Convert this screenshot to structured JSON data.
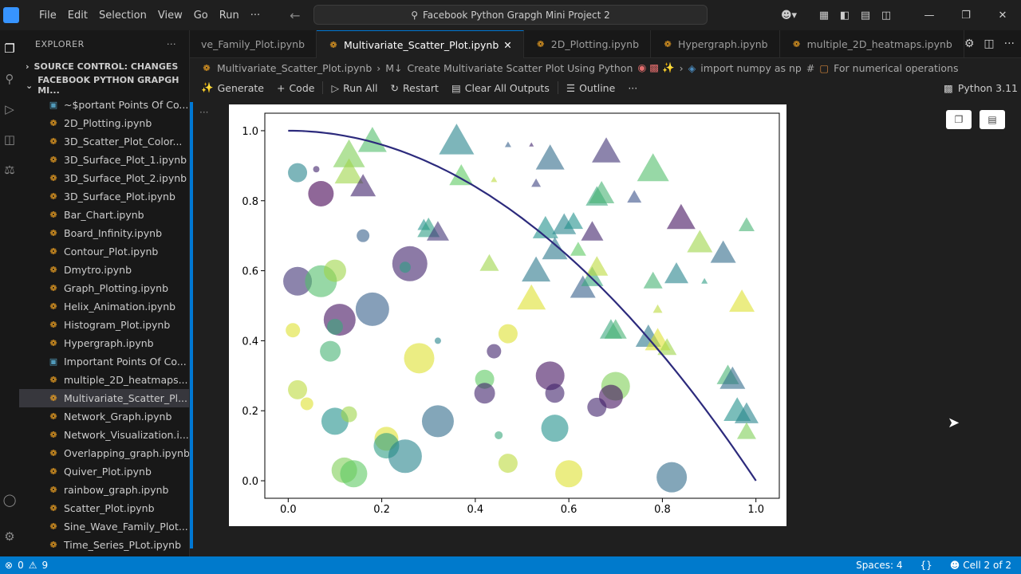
{
  "menu": [
    "File",
    "Edit",
    "Selection",
    "View",
    "Go",
    "Run",
    "···"
  ],
  "search": {
    "text": "Facebook Python Grapgh Mini Project 2"
  },
  "explorer": {
    "title": "EXPLORER",
    "source_control": "SOURCE CONTROL: CHANGES",
    "folder": "FACEBOOK PYTHON GRAPGH MI...",
    "files": [
      {
        "name": "~$portant Points Of Co...",
        "type": "doc"
      },
      {
        "name": "2D_Plotting.ipynb",
        "type": "nb"
      },
      {
        "name": "3D_Scatter_Plot_Color...",
        "type": "nb"
      },
      {
        "name": "3D_Surface_Plot_1.ipynb",
        "type": "nb"
      },
      {
        "name": "3D_Surface_Plot_2.ipynb",
        "type": "nb"
      },
      {
        "name": "3D_Surface_Plot.ipynb",
        "type": "nb"
      },
      {
        "name": "Bar_Chart.ipynb",
        "type": "nb"
      },
      {
        "name": "Board_Infinity.ipynb",
        "type": "nb"
      },
      {
        "name": "Contour_Plot.ipynb",
        "type": "nb"
      },
      {
        "name": "Dmytro.ipynb",
        "type": "nb"
      },
      {
        "name": "Graph_Plotting.ipynb",
        "type": "nb"
      },
      {
        "name": "Helix_Animation.ipynb",
        "type": "nb"
      },
      {
        "name": "Histogram_Plot.ipynb",
        "type": "nb"
      },
      {
        "name": "Hypergraph.ipynb",
        "type": "nb"
      },
      {
        "name": "Important Points Of Co...",
        "type": "doc"
      },
      {
        "name": "multiple_2D_heatmaps...",
        "type": "nb"
      },
      {
        "name": "Multivariate_Scatter_Pl...",
        "type": "nb"
      },
      {
        "name": "Network_Graph.ipynb",
        "type": "nb"
      },
      {
        "name": "Network_Visualization.i...",
        "type": "nb"
      },
      {
        "name": "Overlapping_graph.ipynb",
        "type": "nb"
      },
      {
        "name": "Quiver_Plot.ipynb",
        "type": "nb"
      },
      {
        "name": "rainbow_graph.ipynb",
        "type": "nb"
      },
      {
        "name": "Scatter_Plot.ipynb",
        "type": "nb"
      },
      {
        "name": "Sine_Wave_Family_Plot...",
        "type": "nb"
      },
      {
        "name": "Time_Series_PLot.ipynb",
        "type": "nb"
      }
    ]
  },
  "tabs": [
    "ve_Family_Plot.ipynb",
    "Multivariate_Scatter_Plot.ipynb",
    "2D_Plotting.ipynb",
    "Hypergraph.ipynb",
    "multiple_2D_heatmaps.ipynb"
  ],
  "breadcrumb": {
    "file": "Multivariate_Scatter_Plot.ipynb",
    "md_prefix": "M↓",
    "cell": "Create Multivariate Scatter Plot Using Python",
    "code": "import numpy as np",
    "hash": "#",
    "comment": "For numerical operations"
  },
  "toolbar": {
    "generate": "Generate",
    "code": "Code",
    "run_all": "Run All",
    "restart": "Restart",
    "clear": "Clear All Outputs",
    "outline": "Outline",
    "more": "···",
    "kernel": "Python 3.11"
  },
  "status": {
    "errors": "0",
    "warnings": "9",
    "spaces": "Spaces: 4",
    "braces": "{}",
    "cell": "Cell 2 of 2"
  },
  "chart_data": {
    "type": "scatter",
    "xlim": [
      -0.05,
      1.05
    ],
    "ylim": [
      -0.05,
      1.05
    ],
    "xticks": [
      "0.0",
      "0.2",
      "0.4",
      "0.6",
      "0.8",
      "1.0"
    ],
    "yticks": [
      "0.0",
      "0.2",
      "0.4",
      "0.6",
      "0.8",
      "1.0"
    ],
    "grid": false,
    "colormap": "viridis",
    "curve": {
      "type": "line",
      "function": "1 - x^2",
      "color": "#2c2a7c"
    },
    "circles": [
      [
        0.02,
        0.88,
        12,
        0.45
      ],
      [
        0.07,
        0.82,
        16,
        0.0
      ],
      [
        0.06,
        0.89,
        4,
        0.1
      ],
      [
        0.16,
        0.7,
        8,
        0.3
      ],
      [
        0.02,
        0.57,
        18,
        0.15
      ],
      [
        0.07,
        0.57,
        20,
        0.7
      ],
      [
        0.1,
        0.6,
        14,
        0.85
      ],
      [
        0.11,
        0.46,
        20,
        0.05
      ],
      [
        0.18,
        0.49,
        21,
        0.3
      ],
      [
        0.26,
        0.62,
        22,
        0.1
      ],
      [
        0.01,
        0.43,
        9,
        0.95
      ],
      [
        0.09,
        0.37,
        13,
        0.65
      ],
      [
        0.28,
        0.35,
        19,
        0.95
      ],
      [
        0.32,
        0.4,
        4,
        0.45
      ],
      [
        0.44,
        0.37,
        9,
        0.1
      ],
      [
        0.47,
        0.42,
        12,
        0.95
      ],
      [
        0.56,
        0.3,
        18,
        0.05
      ],
      [
        0.57,
        0.25,
        12,
        0.1
      ],
      [
        0.7,
        0.27,
        18,
        0.8
      ],
      [
        0.69,
        0.24,
        15,
        0.05
      ],
      [
        0.66,
        0.21,
        12,
        0.1
      ],
      [
        0.42,
        0.29,
        12,
        0.75
      ],
      [
        0.42,
        0.25,
        13,
        0.1
      ],
      [
        0.02,
        0.26,
        12,
        0.9
      ],
      [
        0.04,
        0.22,
        8,
        0.95
      ],
      [
        0.1,
        0.17,
        17,
        0.5
      ],
      [
        0.13,
        0.19,
        10,
        0.85
      ],
      [
        0.21,
        0.12,
        15,
        0.95
      ],
      [
        0.21,
        0.1,
        16,
        0.55
      ],
      [
        0.25,
        0.07,
        21,
        0.45
      ],
      [
        0.32,
        0.17,
        20,
        0.35
      ],
      [
        0.45,
        0.13,
        5,
        0.6
      ],
      [
        0.57,
        0.15,
        17,
        0.5
      ],
      [
        0.6,
        0.02,
        17,
        0.95
      ],
      [
        0.47,
        0.05,
        12,
        0.9
      ],
      [
        0.12,
        0.03,
        16,
        0.8
      ],
      [
        0.14,
        0.02,
        17,
        0.75
      ],
      [
        0.82,
        0.01,
        19,
        0.35
      ],
      [
        0.25,
        0.61,
        7,
        0.55
      ],
      [
        0.1,
        0.44,
        10,
        0.6
      ]
    ],
    "triangles": [
      [
        0.13,
        0.93,
        20,
        0.8
      ],
      [
        0.18,
        0.97,
        18,
        0.7
      ],
      [
        0.13,
        0.88,
        18,
        0.85
      ],
      [
        0.16,
        0.84,
        16,
        0.1
      ],
      [
        0.36,
        0.97,
        22,
        0.45
      ],
      [
        0.37,
        0.87,
        15,
        0.75
      ],
      [
        0.44,
        0.86,
        4,
        0.9
      ],
      [
        0.47,
        0.96,
        4,
        0.3
      ],
      [
        0.52,
        0.96,
        3,
        0.1
      ],
      [
        0.56,
        0.92,
        18,
        0.35
      ],
      [
        0.53,
        0.85,
        6,
        0.2
      ],
      [
        0.68,
        0.94,
        18,
        0.15
      ],
      [
        0.78,
        0.89,
        20,
        0.7
      ],
      [
        0.66,
        0.81,
        14,
        0.6
      ],
      [
        0.67,
        0.82,
        16,
        0.65
      ],
      [
        0.74,
        0.81,
        9,
        0.25
      ],
      [
        0.29,
        0.73,
        8,
        0.5
      ],
      [
        0.3,
        0.72,
        14,
        0.55
      ],
      [
        0.32,
        0.71,
        14,
        0.15
      ],
      [
        0.55,
        0.72,
        16,
        0.5
      ],
      [
        0.59,
        0.73,
        15,
        0.45
      ],
      [
        0.61,
        0.74,
        12,
        0.5
      ],
      [
        0.65,
        0.71,
        14,
        0.1
      ],
      [
        0.84,
        0.75,
        18,
        0.05
      ],
      [
        0.88,
        0.68,
        16,
        0.85
      ],
      [
        0.93,
        0.65,
        16,
        0.35
      ],
      [
        0.98,
        0.73,
        10,
        0.65
      ],
      [
        0.43,
        0.62,
        12,
        0.85
      ],
      [
        0.53,
        0.6,
        18,
        0.4
      ],
      [
        0.57,
        0.66,
        16,
        0.4
      ],
      [
        0.62,
        0.66,
        10,
        0.75
      ],
      [
        0.63,
        0.55,
        16,
        0.3
      ],
      [
        0.65,
        0.58,
        14,
        0.6
      ],
      [
        0.66,
        0.61,
        14,
        0.9
      ],
      [
        0.78,
        0.57,
        12,
        0.65
      ],
      [
        0.83,
        0.59,
        15,
        0.45
      ],
      [
        0.89,
        0.57,
        4,
        0.55
      ],
      [
        0.52,
        0.52,
        18,
        0.95
      ],
      [
        0.97,
        0.51,
        16,
        0.95
      ],
      [
        0.79,
        0.49,
        6,
        0.9
      ],
      [
        0.69,
        0.43,
        14,
        0.6
      ],
      [
        0.7,
        0.43,
        14,
        0.65
      ],
      [
        0.77,
        0.41,
        16,
        0.4
      ],
      [
        0.79,
        0.4,
        16,
        0.95
      ],
      [
        0.81,
        0.38,
        12,
        0.85
      ],
      [
        0.94,
        0.3,
        14,
        0.65
      ],
      [
        0.95,
        0.29,
        16,
        0.35
      ],
      [
        0.96,
        0.2,
        17,
        0.5
      ],
      [
        0.98,
        0.19,
        15,
        0.45
      ],
      [
        0.98,
        0.14,
        12,
        0.8
      ]
    ]
  }
}
